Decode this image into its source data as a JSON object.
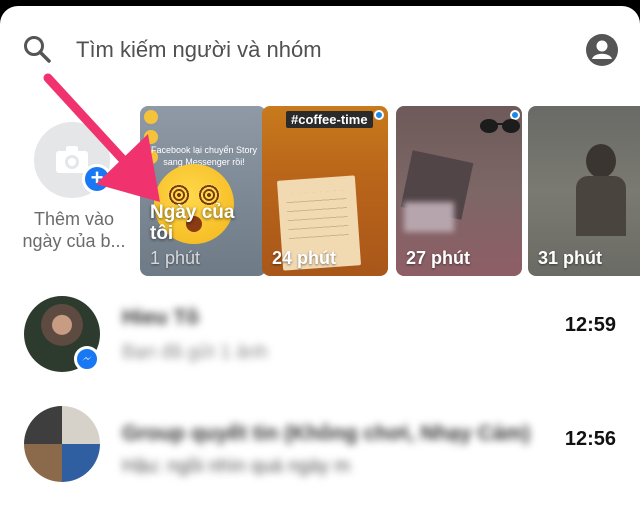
{
  "search": {
    "placeholder": "Tìm kiếm người và nhóm"
  },
  "stories": {
    "add": {
      "label": "Thêm vào ngày của b..."
    },
    "cards": [
      {
        "title": "Ngày của tôi",
        "time": "1 phút",
        "caption": "Facebook lại chuyển Story sang Messenger rồi!"
      },
      {
        "tag": "#coffee-time",
        "time": "24 phút"
      },
      {
        "time": "27 phút"
      },
      {
        "time": "31 phút"
      }
    ]
  },
  "conversations": [
    {
      "name": "Hieu Tô",
      "preview": "Bạn đã gửi 1 ảnh",
      "time": "12:59"
    },
    {
      "name": "Group quyết tin (Không chơi, Nhạy Cảm)",
      "preview": "Hậu: ngồi nhìn quá ngày m",
      "time": "12:56"
    }
  ],
  "colors": {
    "accent": "#1877f2",
    "arrow": "#f0336f",
    "unread_dot": "#1e88e5"
  },
  "icons": {
    "search": "search-icon",
    "profile": "profile-icon",
    "camera": "camera-icon",
    "plus": "plus-icon",
    "messenger": "messenger-icon"
  }
}
